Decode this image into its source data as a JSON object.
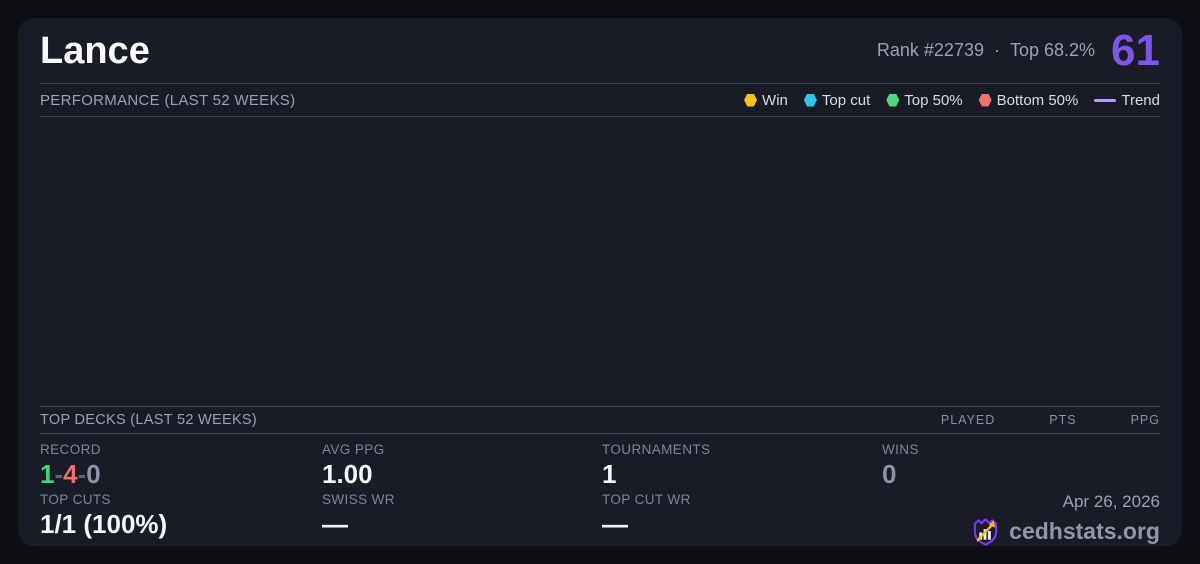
{
  "header": {
    "title": "Lance",
    "rank": "Rank #22739",
    "separator": "·",
    "percentile": "Top 68.2%",
    "score": "61",
    "score_color": "#7e55ea"
  },
  "performance": {
    "heading": "PERFORMANCE (LAST 52 WEEKS)",
    "legend": [
      {
        "label": "Win",
        "color": "#f0c419",
        "swatch": "dot"
      },
      {
        "label": "Top cut",
        "color": "#2cc8e8",
        "swatch": "dot"
      },
      {
        "label": "Top 50%",
        "color": "#49d985",
        "swatch": "dot"
      },
      {
        "label": "Bottom 50%",
        "color": "#f37070",
        "swatch": "dot"
      },
      {
        "label": "Trend",
        "color": "#b39df5",
        "swatch": "line"
      }
    ]
  },
  "top_decks": {
    "heading": "TOP DECKS (LAST 52 WEEKS)",
    "columns": [
      "PLAYED",
      "PTS",
      "PPG"
    ]
  },
  "stats": {
    "record": {
      "label": "RECORD",
      "wins": "1",
      "losses": "4",
      "draws": "0",
      "separator": "-",
      "win_color": "#42d77d",
      "loss_color": "#f06e6e",
      "draw_color": "#8d93a6",
      "separator_color": "#5d6375"
    },
    "avg_ppg": {
      "label": "AVG PPG",
      "value": "1.00"
    },
    "tournaments": {
      "label": "TOURNAMENTS",
      "value": "1"
    },
    "wins": {
      "label": "WINS",
      "value": "0"
    },
    "top_cuts": {
      "label": "TOP CUTS",
      "value": "1/1 (100%)"
    },
    "swiss_wr": {
      "label": "SWISS WR",
      "value": "—"
    },
    "top_cut_wr": {
      "label": "TOP CUT WR",
      "value": "—"
    }
  },
  "footer": {
    "date": "Apr 26, 2026",
    "brand": "cedhstats.org"
  },
  "chart_data": {
    "type": "scatter",
    "title": "PERFORMANCE (LAST 52 WEEKS)",
    "x_span_weeks": 52,
    "grid": false,
    "axes_visible": false,
    "legend_position": "top-right",
    "series": [
      {
        "name": "Win",
        "color": "#f0c419",
        "marker": "hexagon",
        "points": []
      },
      {
        "name": "Top cut",
        "color": "#2cc8e8",
        "marker": "hexagon",
        "points": []
      },
      {
        "name": "Top 50%",
        "color": "#49d985",
        "marker": "hexagon",
        "points": []
      },
      {
        "name": "Bottom 50%",
        "color": "#f37070",
        "marker": "hexagon",
        "points": []
      },
      {
        "name": "Trend",
        "color": "#b39df5",
        "marker": "line",
        "points": []
      }
    ],
    "note": "chart plot area is rendered empty in the screenshot - no data points or trend line drawn"
  }
}
